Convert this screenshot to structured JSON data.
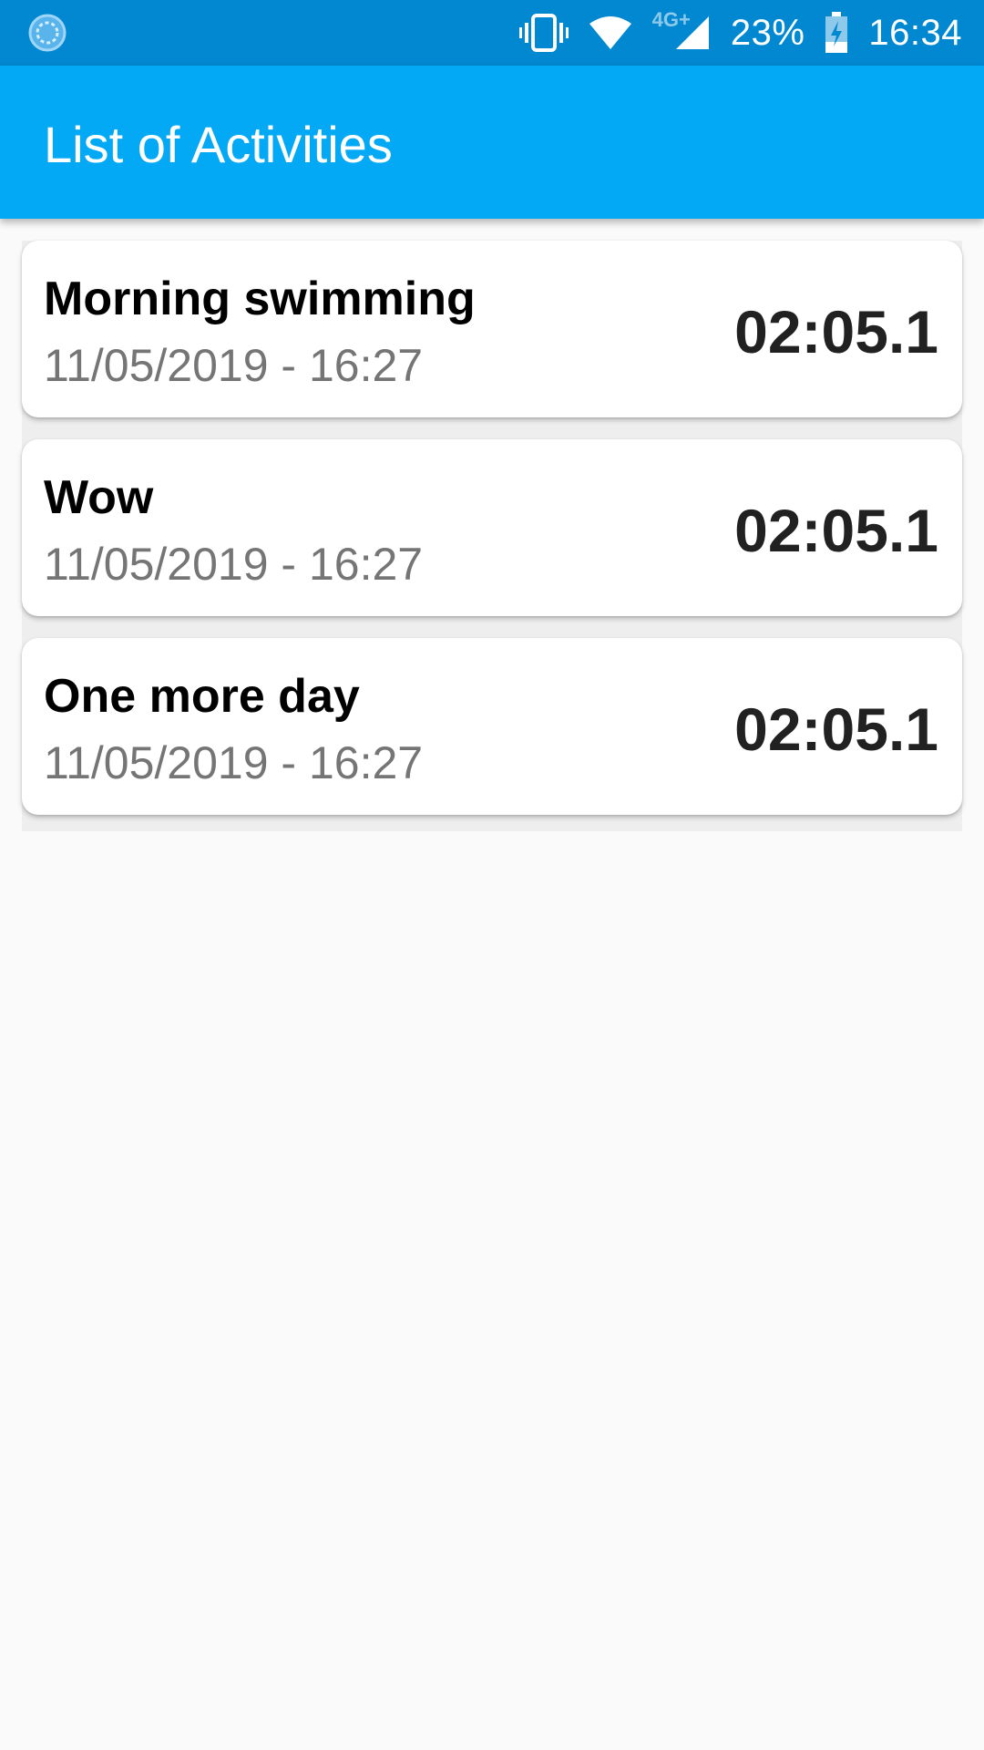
{
  "status_bar": {
    "network_label": "4G+",
    "battery_percent": "23%",
    "time": "16:34",
    "icons": [
      "sync-icon",
      "vibrate-icon",
      "wifi-icon",
      "signal-icon",
      "battery-charging-icon"
    ]
  },
  "app_bar": {
    "title": "List of Activities"
  },
  "activities": [
    {
      "title": "Morning swimming",
      "date": "11/05/2019 - 16:27",
      "duration": "02:05.1"
    },
    {
      "title": "Wow",
      "date": "11/05/2019 - 16:27",
      "duration": "02:05.1"
    },
    {
      "title": "One more day",
      "date": "11/05/2019 - 16:27",
      "duration": "02:05.1"
    }
  ],
  "colors": {
    "status_bar": "#0288d1",
    "app_bar": "#03a9f4",
    "background": "#fafafa",
    "date_text": "#757575"
  }
}
